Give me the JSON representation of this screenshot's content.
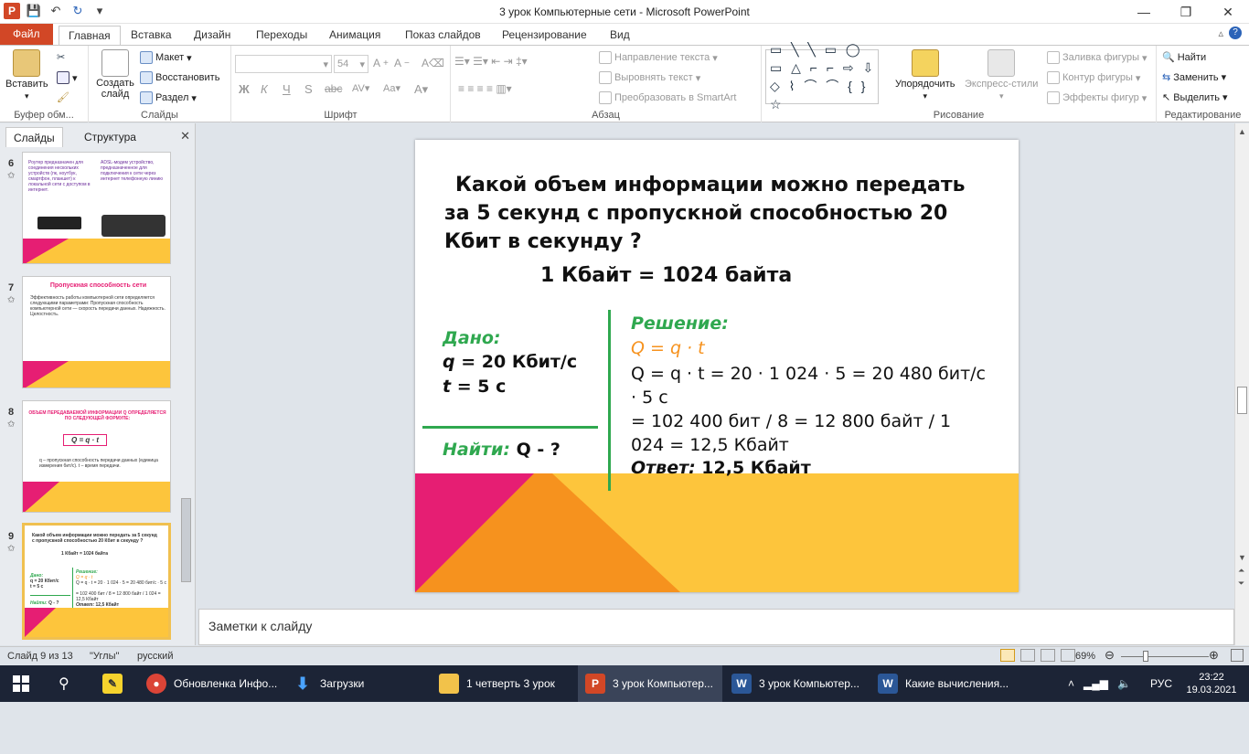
{
  "window": {
    "title": "3 урок Компьютерные сети - Microsoft PowerPoint"
  },
  "ribbon": {
    "tabs": [
      "Файл",
      "Главная",
      "Вставка",
      "Дизайн",
      "Переходы",
      "Анимация",
      "Показ слайдов",
      "Рецензирование",
      "Вид"
    ],
    "clipboard": {
      "label": "Буфер обм...",
      "paste": "Вставить"
    },
    "slides": {
      "label": "Слайды",
      "new_slide": "Создать слайд",
      "layout": "Макет",
      "reset": "Восстановить",
      "section": "Раздел"
    },
    "font": {
      "label": "Шрифт",
      "size": "54"
    },
    "paragraph": {
      "label": "Абзац",
      "text_direction": "Направление текста",
      "align_text": "Выровнять текст",
      "smartart": "Преобразовать в SmartArt"
    },
    "drawing": {
      "label": "Рисование",
      "arrange": "Упорядочить",
      "quick_styles": "Экспресс-стили",
      "shape_fill": "Заливка фигуры",
      "shape_outline": "Контур фигуры",
      "shape_effects": "Эффекты фигур"
    },
    "editing": {
      "label": "Редактирование",
      "find": "Найти",
      "replace": "Заменить",
      "select": "Выделить"
    }
  },
  "pane": {
    "tab_slides": "Слайды",
    "tab_outline": "Структура",
    "thumbs": [
      {
        "num": "6",
        "text1": "Роутер предназначен для соединения нескольких устройств (пк, ноутбук, смартфон, планшет) к локальной сети с доступом в интернет.",
        "text2": "ADSL-модем устройство, предназначенное для подключения к сети через интернет телефонную линию"
      },
      {
        "num": "7",
        "title": "Пропускная способность сети",
        "text": "Эффективность работы компьютерной сети определяется следующими параметрами: Пропускная способность компьютерной сети — скорость передачи данных. Надежность. Целостность."
      },
      {
        "num": "8",
        "title": "ОБЪЕМ ПЕРЕДАВАЕМОЙ ИНФОРМАЦИИ Q ОПРЕДЕЛЯЕТСЯ ПО СЛЕДУЮЩЕЙ ФОРМУЛЕ:",
        "formula": "Q = q · t",
        "text": "q – пропускная способность передачи данных (единица измерения бит/с). t – время передачи."
      },
      {
        "num": "9"
      }
    ]
  },
  "slide": {
    "question": "Какой объем информации можно передать за 5 секунд с пропускной способностью 20 Кбит в секунду ?",
    "conversion": "1 Кбайт = 1024 байта",
    "given_label": "Дано:",
    "given_q_var": "q",
    "given_q": " = 20 Кбит/с",
    "given_t_var": "t",
    "given_t": " = 5 с",
    "find_label": "Найти:",
    "find_value": " Q - ?",
    "solution_label": "Решение:",
    "formula": "Q = q · t",
    "calc1": "Q = q · t = 20 · 1 024 · 5 = 20 480 бит/с · 5 с",
    "calc2": "= 102 400 бит / 8 = 12 800 байт / 1 024 = 12,5 Кбайт",
    "answer_label": "Ответ:",
    "answer_value": " 12,5 Кбайт"
  },
  "notes": {
    "placeholder": "Заметки к слайду"
  },
  "status": {
    "slide_of": "Слайд 9 из 13",
    "theme": "\"Углы\"",
    "language": "русский",
    "zoom": "69%"
  },
  "taskbar": {
    "items": [
      {
        "label": "Обновленка Инфо...",
        "icon": "chrome-icon"
      },
      {
        "label": "Загрузки",
        "icon": "download-icon"
      },
      {
        "label": "1 четверть 3 урок",
        "icon": "folder-icon"
      },
      {
        "label": "3 урок Компьютер...",
        "icon": "powerpoint-icon"
      },
      {
        "label": "3 урок Компьютер...",
        "icon": "word-icon"
      },
      {
        "label": "Какие вычисления...",
        "icon": "word-icon"
      }
    ],
    "lang": "РУС",
    "time": "23:22",
    "date": "19.03.2021"
  },
  "colors": {
    "accent_yellow": "#fdc53c",
    "accent_orange": "#f6921e",
    "accent_pink": "#e61e73",
    "green": "#2fa84f",
    "ppt_red": "#d24726"
  }
}
